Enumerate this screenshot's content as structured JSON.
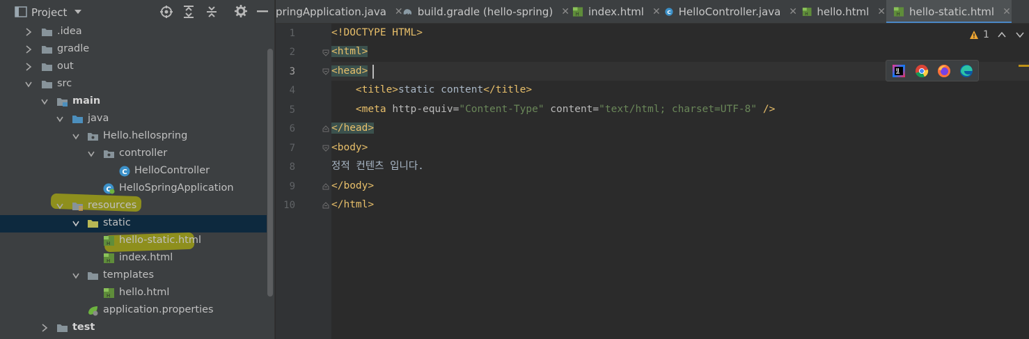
{
  "project_panel": {
    "title": "Project",
    "tree": [
      {
        "label": "idea_label",
        "text": ".idea"
      },
      {
        "text": "gradle"
      },
      {
        "text": "out"
      },
      {
        "text": "src"
      },
      {
        "text": "main"
      },
      {
        "text": "java"
      },
      {
        "text": "Hello.hellospring"
      },
      {
        "text": "controller"
      },
      {
        "text": "HelloController"
      },
      {
        "text": "HelloSpringApplication"
      },
      {
        "text": "resources"
      },
      {
        "text": "static"
      },
      {
        "text": "hello-static.html"
      },
      {
        "text": "index.html"
      },
      {
        "text": "templates"
      },
      {
        "text": "hello.html"
      },
      {
        "text": "application.properties"
      },
      {
        "text": "test"
      }
    ]
  },
  "tabs": [
    {
      "label": "pringApplication.java"
    },
    {
      "label": "build.gradle (hello-spring)"
    },
    {
      "label": "index.html"
    },
    {
      "label": "HelloController.java"
    },
    {
      "label": "hello.html"
    },
    {
      "label": "hello-static.html"
    }
  ],
  "close_glyph": "✕",
  "line_numbers": [
    "1",
    "2",
    "3",
    "4",
    "5",
    "6",
    "7",
    "8",
    "9",
    "10"
  ],
  "code": {
    "l1": "<!DOCTYPE HTML>",
    "l2": "<html>",
    "l3": "<head>",
    "l4_open": "<title>",
    "l4_text": "static content",
    "l4_close": "</title>",
    "l5_tag": "<meta ",
    "l5_attr1": "http-equiv=",
    "l5_val1": "\"Content-Type\"",
    "l5_attr2": " content=",
    "l5_val2": "\"text/html; charset=UTF-8\"",
    "l5_end": " />",
    "l6": "</head>",
    "l7": "<body>",
    "l8": "정적 컨텐츠 입니다.",
    "l9": "</body>",
    "l10": "</html>"
  },
  "inspection": {
    "count": "1"
  },
  "colors": {
    "accent": "#4a88c7",
    "tag": "#e8bf6a",
    "string": "#6a8759",
    "warning": "#be9117",
    "highlight": "#d2d200"
  }
}
